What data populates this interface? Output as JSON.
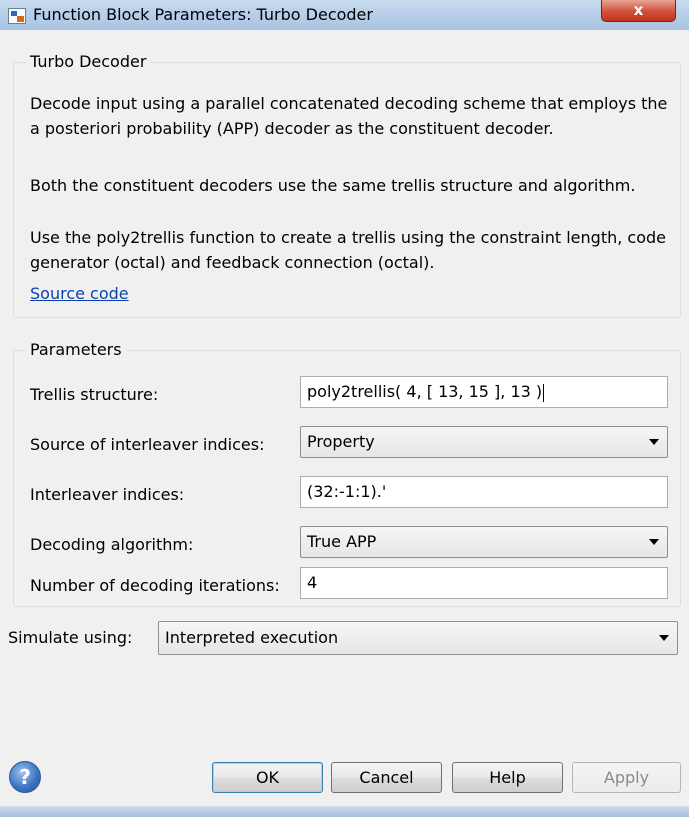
{
  "window": {
    "title": "Function Block Parameters: Turbo Decoder",
    "close_label": "x"
  },
  "description": {
    "group_title": "Turbo Decoder",
    "paragraph_1": "Decode input using a parallel concatenated decoding scheme that employs the a posteriori probability (APP) decoder as the constituent decoder.",
    "paragraph_2": "Both the constituent decoders use the same trellis structure and algorithm.",
    "paragraph_3": "Use the poly2trellis function to create a trellis using the constraint length, code generator (octal) and feedback connection (octal).",
    "link": "Source code"
  },
  "parameters": {
    "group_title": "Parameters",
    "trellis_label": "Trellis structure:",
    "trellis_value": "poly2trellis( 4, [ 13, 15 ], 13 )",
    "interleaver_source_label": "Source of interleaver indices:",
    "interleaver_source_value": "Property",
    "interleaver_indices_label": "Interleaver indices:",
    "interleaver_indices_value": "(32:-1:1).'",
    "algorithm_label": "Decoding algorithm:",
    "algorithm_value": "True APP",
    "iterations_label": "Number of decoding iterations:",
    "iterations_value": "4"
  },
  "simulate": {
    "label": "Simulate using:",
    "value": "Interpreted execution"
  },
  "buttons": {
    "help_icon": "?",
    "ok": "OK",
    "cancel": "Cancel",
    "help": "Help",
    "apply": "Apply"
  },
  "icons": {
    "window": "block-parameters-icon",
    "help": "help-circle-icon",
    "dropdown": "chevron-down-icon"
  }
}
